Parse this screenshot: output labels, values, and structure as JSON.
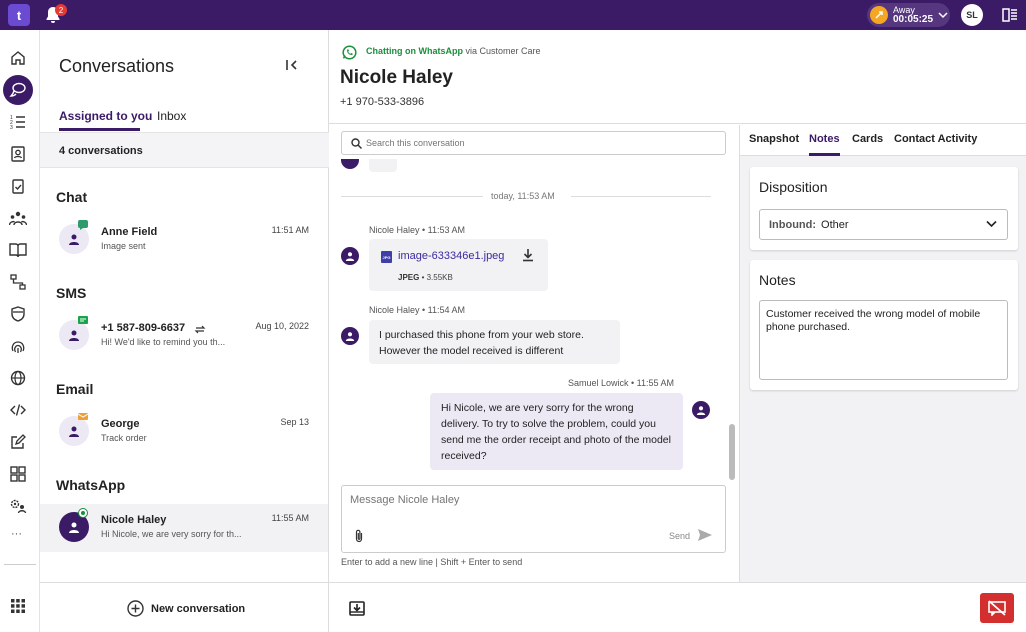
{
  "app": {
    "logo_text": "t",
    "notifications_count": "2",
    "status": {
      "label": "Away",
      "timer": "00:05:25"
    },
    "user_initials": "SL"
  },
  "conversations": {
    "title": "Conversations",
    "tabs": [
      {
        "label": "Assigned to you"
      },
      {
        "label": "Inbox"
      }
    ],
    "count_text": "4 conversations",
    "groups": [
      {
        "title": "Chat",
        "items": [
          {
            "name": "Anne Field",
            "snippet": "Image sent",
            "time": "11:51 AM"
          }
        ]
      },
      {
        "title": "SMS",
        "items": [
          {
            "name": "+1 587-809-6637",
            "snippet": "Hi! We'd like to remind you th...",
            "time": "Aug 10, 2022"
          }
        ]
      },
      {
        "title": "Email",
        "items": [
          {
            "name": "George",
            "snippet": "Track order",
            "time": "Sep 13"
          }
        ]
      },
      {
        "title": "WhatsApp",
        "items": [
          {
            "name": "Nicole Haley",
            "snippet": "Hi Nicole, we are very sorry for th...",
            "time": "11:55 AM"
          }
        ]
      }
    ],
    "new_conversation_label": "New conversation"
  },
  "header": {
    "channel_text": "Chatting on WhatsApp",
    "via_text": "via Customer Care",
    "contact_name": "Nicole Haley",
    "phone": "+1 970-533-3896"
  },
  "chat": {
    "search_placeholder": "Search this conversation",
    "divider": "today, 11:53 AM",
    "messages": [
      {
        "meta": "Nicole Haley • 11:53 AM",
        "file_name": "image-633346e1.jpeg",
        "file_type": "JPEG",
        "file_size": "• 3.55KB",
        "file_badge": "JPG"
      },
      {
        "meta": "Nicole Haley • 11:54 AM",
        "text": "I purchased this phone from your web store. However the model received is different"
      },
      {
        "meta": "Samuel Lowick • 11:55 AM",
        "text": "Hi Nicole, we are very sorry for the wrong delivery. To try to solve the problem, could you send me the order receipt and photo of the model received?"
      }
    ],
    "compose_placeholder": "Message Nicole Haley",
    "send_label": "Send",
    "hint": "Enter to add a new line | Shift + Enter to send"
  },
  "right_panel": {
    "tabs": [
      {
        "label": "Snapshot"
      },
      {
        "label": "Notes"
      },
      {
        "label": "Cards"
      },
      {
        "label": "Contact Activity"
      }
    ],
    "disposition": {
      "title": "Disposition",
      "label": "Inbound:",
      "value": "Other"
    },
    "notes": {
      "title": "Notes",
      "text": "Customer received the wrong model of mobile phone purchased."
    }
  },
  "colors": {
    "brand": "#3b1a66",
    "accent": "#6a4bd1",
    "whatsapp": "#1a8f3c",
    "danger": "#d32f2f",
    "away": "#f5a623"
  }
}
